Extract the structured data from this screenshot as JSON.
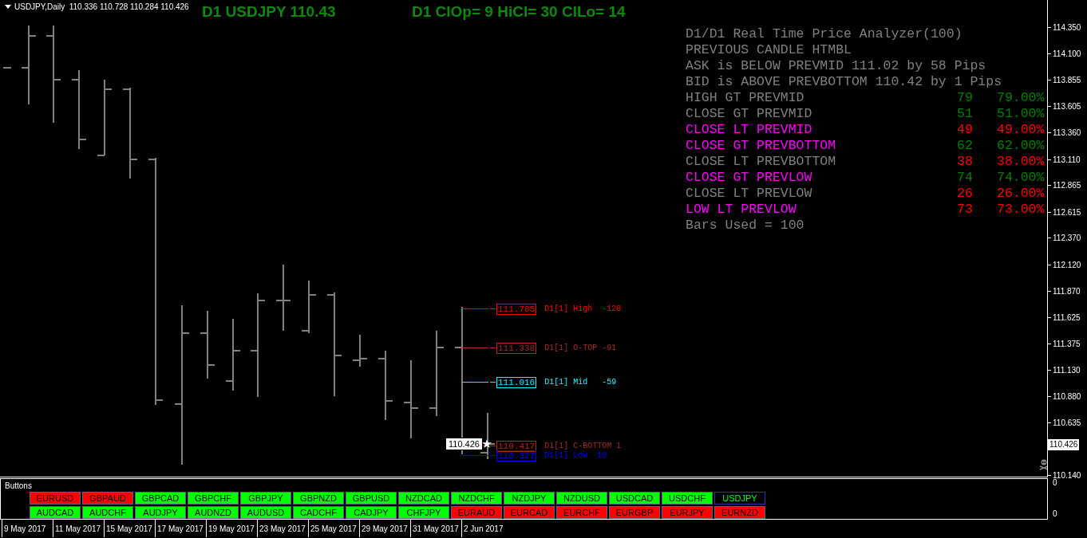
{
  "chart": {
    "symbol_info": "USDJPY,Daily  110.336 110.728 110.284 110.426",
    "headlines": [
      "D1 USDJPY 110.43",
      "D1 ClOp= 9 HiCl= 30 ClLo= 14"
    ],
    "analyzer": {
      "title_lines": [
        "D1/D1 Real Time Price Analyzer(100)",
        "PREVIOUS CANDLE HTMBL",
        "ASK is BELOW PREVMID 111.02 by 58 Pips",
        "BID is ABOVE PREVBOTTOM 110.42 by 1 Pips"
      ],
      "rows": [
        {
          "label": "HIGH GT PREVMID",
          "count": "79",
          "percent": "79.00%",
          "color": "#808080",
          "kind": "up"
        },
        {
          "label": "CLOSE GT PREVMID",
          "count": "51",
          "percent": "51.00%",
          "color": "#808080",
          "kind": "up"
        },
        {
          "label": "CLOSE LT PREVMID",
          "count": "49",
          "percent": "49.00%",
          "color": "#ff00ff",
          "kind": "down"
        },
        {
          "label": "CLOSE GT PREVBOTTOM",
          "count": "62",
          "percent": "62.00%",
          "color": "#ff00ff",
          "kind": "up"
        },
        {
          "label": "CLOSE LT PREVBOTTOM",
          "count": "38",
          "percent": "38.00%",
          "color": "#808080",
          "kind": "down"
        },
        {
          "label": "CLOSE GT PREVLOW",
          "count": "74",
          "percent": "74.00%",
          "color": "#ff00ff",
          "kind": "up"
        },
        {
          "label": "CLOSE LT PREVLOW",
          "count": "26",
          "percent": "26.00%",
          "color": "#808080",
          "kind": "down"
        },
        {
          "label": "LOW LT PREVLOW",
          "count": "73",
          "percent": "73.00%",
          "color": "#ff00ff",
          "kind": "down"
        }
      ],
      "footer": "Bars Used = 100"
    },
    "price_levels": [
      {
        "price": "111.705",
        "label": "D1[1] High  -128",
        "color": "#ff0000"
      },
      {
        "price": "111.338",
        "label": "D1[1] O-TOP -91",
        "color": "#a52a2a"
      },
      {
        "price": "111.016",
        "label": "D1[1] Mid   -59",
        "color": "#00ffff"
      },
      {
        "price": "110.417",
        "label": "D1[1] C-BOTTOM 1",
        "color": "#a52a2a"
      },
      {
        "price": "110.327",
        "label": "D1[1] Low  10",
        "color": "#0000ff"
      }
    ],
    "bid_label": "110.426",
    "price_axis": [
      "114.350",
      "114.100",
      "113.855",
      "113.605",
      "113.360",
      "113.110",
      "112.865",
      "112.615",
      "112.370",
      "112.120",
      "111.870",
      "111.625",
      "111.375",
      "111.130",
      "110.880",
      "110.635",
      "110.140"
    ],
    "current_price": "110.426"
  },
  "indicator_panel": {
    "title": "Buttons",
    "axis": [
      "0",
      "0"
    ],
    "buttons": [
      {
        "label": "EURUSD",
        "color": "#ff0000",
        "selected": false
      },
      {
        "label": "GBPAUD",
        "color": "#ff0000",
        "selected": false
      },
      {
        "label": "GBPCAD",
        "color": "#00ff00",
        "selected": false
      },
      {
        "label": "GBPCHF",
        "color": "#00ff00",
        "selected": false
      },
      {
        "label": "GBPJPY",
        "color": "#00ff00",
        "selected": false
      },
      {
        "label": "GBPNZD",
        "color": "#00ff00",
        "selected": false
      },
      {
        "label": "GBPUSD",
        "color": "#00ff00",
        "selected": false
      },
      {
        "label": "NZDCAD",
        "color": "#00ff00",
        "selected": false
      },
      {
        "label": "NZDCHF",
        "color": "#00ff00",
        "selected": false
      },
      {
        "label": "NZDJPY",
        "color": "#00ff00",
        "selected": false
      },
      {
        "label": "NZDUSD",
        "color": "#00ff00",
        "selected": false
      },
      {
        "label": "USDCAD",
        "color": "#00ff00",
        "selected": false
      },
      {
        "label": "USDCHF",
        "color": "#00ff00",
        "selected": false
      },
      {
        "label": "USDJPY",
        "color": "#00ff00",
        "selected": true
      },
      {
        "label": "AUDCAD",
        "color": "#00ff00",
        "selected": false
      },
      {
        "label": "AUDCHF",
        "color": "#00ff00",
        "selected": false
      },
      {
        "label": "AUDJPY",
        "color": "#00ff00",
        "selected": false
      },
      {
        "label": "AUDNZD",
        "color": "#00ff00",
        "selected": false
      },
      {
        "label": "AUDUSD",
        "color": "#00ff00",
        "selected": false
      },
      {
        "label": "CADCHF",
        "color": "#00ff00",
        "selected": false
      },
      {
        "label": "CADJPY",
        "color": "#00ff00",
        "selected": false
      },
      {
        "label": "CHFJPY",
        "color": "#00ff00",
        "selected": false
      },
      {
        "label": "EURAUD",
        "color": "#ff0000",
        "selected": false
      },
      {
        "label": "EURCAD",
        "color": "#ff0000",
        "selected": false
      },
      {
        "label": "EURCHF",
        "color": "#ff0000",
        "selected": false
      },
      {
        "label": "EURGBP",
        "color": "#ff0000",
        "selected": false
      },
      {
        "label": "EURJPY",
        "color": "#ff0000",
        "selected": false
      },
      {
        "label": "EURNZD",
        "color": "#ff0000",
        "selected": false
      }
    ]
  },
  "date_axis": [
    "9 May 2017",
    "11 May 2017",
    "15 May 2017",
    "17 May 2017",
    "19 May 2017",
    "23 May 2017",
    "25 May 2017",
    "29 May 2017",
    "31 May 2017",
    "2 Jun 2017"
  ]
}
